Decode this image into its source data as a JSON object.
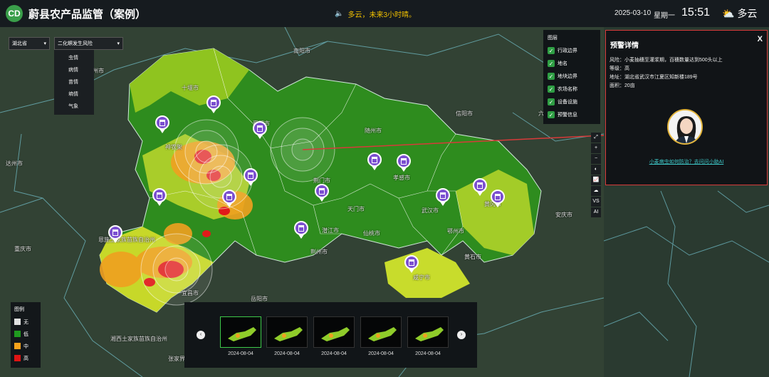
{
  "header": {
    "logo_text": "CD",
    "title": "蔚县农产品监管（案例）",
    "notice": "多云，未来3小时晴。",
    "date": "2025-03-10",
    "weekday": "星期一",
    "time": "15:51",
    "weather": "多云"
  },
  "filters": {
    "province": "湖北省",
    "layer": "二化螟发生风险",
    "options": [
      "虫情",
      "病情",
      "苗情",
      "墒情",
      "气象"
    ]
  },
  "layers": {
    "title": "图层",
    "items": [
      "行政边界",
      "地名",
      "地块边界",
      "农场名称",
      "设备设施",
      "预警信息"
    ]
  },
  "tools": [
    "⤢",
    "+",
    "−",
    "◐",
    "📈",
    "☁",
    "VS",
    "AI"
  ],
  "legend": {
    "title": "图例",
    "items": [
      {
        "label": "无",
        "color": "#e0e0e0"
      },
      {
        "label": "低",
        "color": "#1f9a1f"
      },
      {
        "label": "中",
        "color": "#f5a21b"
      },
      {
        "label": "高",
        "color": "#e01414"
      }
    ]
  },
  "timeline": {
    "prev": "‹",
    "next": "›",
    "dates": [
      "2024-08-04",
      "2024-08-04",
      "2024-08-04",
      "2024-08-04",
      "2024-08-04"
    ]
  },
  "map_labels": [
    "南阳市",
    "十堰市",
    "神农架",
    "襄阳市",
    "随州市",
    "荆门市",
    "孝感市",
    "天门市",
    "潜江市",
    "仙桃市",
    "荆州市",
    "武汉市",
    "鄂州市",
    "黄冈市",
    "黄石市",
    "咸宁市",
    "恩施土家族苗族自治州",
    "宜昌市",
    "达州市",
    "重庆市",
    "信阳市",
    "六安市",
    "湘西土家族苗族自治州",
    "张家界",
    "岳阳市",
    "宜州市",
    "安庆市"
  ],
  "alert": {
    "title": "预警详情",
    "close": "X",
    "risk": "风险：小麦抽穗至灌浆期，百穗数量达到500头以上",
    "level": "等级：高",
    "address": "地址：湖北省武汉市江夏区知新楼189号",
    "area": "面积：20亩",
    "link": "小麦病虫如何防治？去问问小助AI"
  }
}
